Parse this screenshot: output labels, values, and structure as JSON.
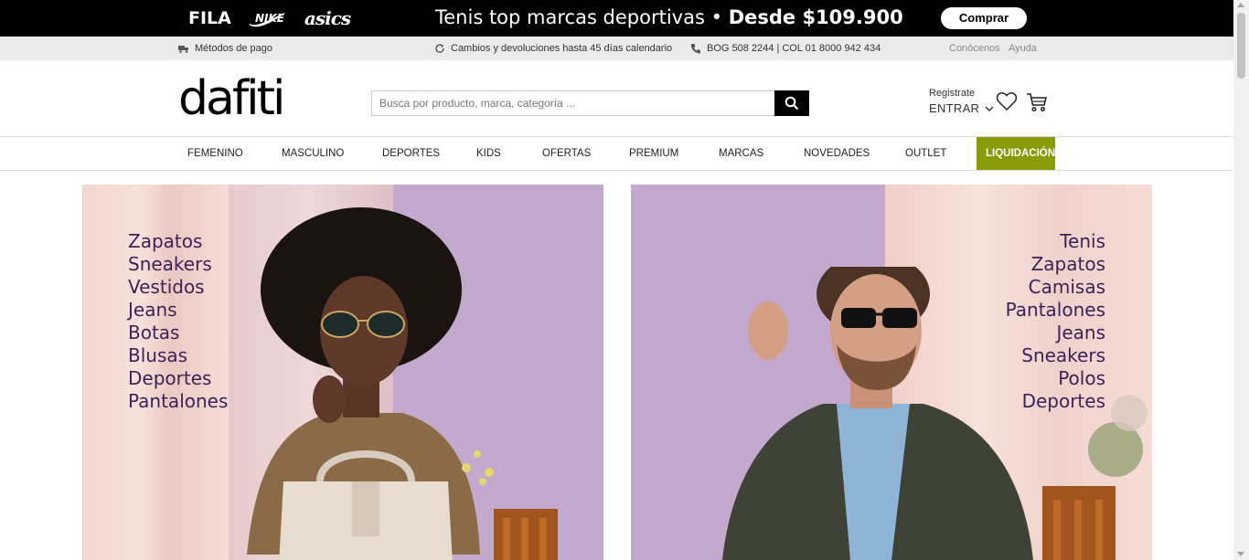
{
  "promo": {
    "brands": [
      "FILA",
      "asics"
    ],
    "brand_icons": [
      "nike-swoosh-icon"
    ],
    "message_prefix": "Tenis top marcas deportivas •",
    "message_highlight": "Desde $109.900",
    "cta_label": "Comprar"
  },
  "infobar": {
    "payment": "Métodos de pago",
    "returns": "Cambios y devoluciones hasta 45 días calendario",
    "phone": "BOG 508 2244 | COL 01 8000 942 434",
    "about": "Conócenos",
    "help": "Ayuda"
  },
  "header": {
    "logo": "dafiti",
    "search_placeholder": "Busca por producto, marca, categoría ...",
    "register": "Registrate",
    "enter": "ENTRAR"
  },
  "nav": {
    "items": [
      "FEMENINO",
      "MASCULINO",
      "DEPORTES",
      "KIDS",
      "OFERTAS",
      "PREMIUM",
      "MARCAS",
      "NOVEDADES",
      "OUTLET"
    ],
    "highlight": "LIQUIDACIÓN",
    "highlight_color": "#8a9a0a"
  },
  "hero": {
    "women": [
      "Zapatos",
      "Sneakers",
      "Vestidos",
      "Jeans",
      "Botas",
      "Blusas",
      "Deportes",
      "Pantalones"
    ],
    "men": [
      "Tenis",
      "Zapatos",
      "Camisas",
      "Pantalones",
      "Jeans",
      "Sneakers",
      "Polos",
      "Deportes"
    ],
    "text_color": "#3d2258",
    "background_color": "#c4a9cf"
  }
}
